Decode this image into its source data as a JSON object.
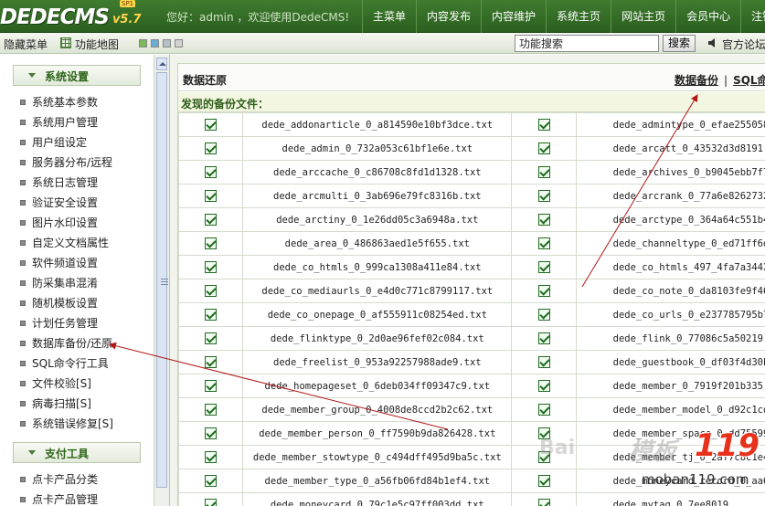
{
  "header": {
    "logo_text": "DEDECMS",
    "logo_version": "v5.7",
    "logo_badge": "SP1",
    "welcome": "您好：admin ，欢迎使用DedeCMS!",
    "nav": [
      "主菜单",
      "内容发布",
      "内容维护",
      "系统主页",
      "网站主页",
      "会员中心",
      "注销"
    ]
  },
  "toolbar": {
    "hide_menu": "隐藏菜单",
    "sitemap": "功能地图",
    "search_value": "功能搜索",
    "search_button": "搜索",
    "forum": "官方论坛",
    "swatch_colors": [
      "#7cb95a",
      "#6aaed8",
      "#b9bfc6",
      "#d2d2d2"
    ]
  },
  "sidebar": {
    "section1": "系统设置",
    "items1": [
      "系统基本参数",
      "系统用户管理",
      "用户组设定",
      "服务器分布/远程",
      "系统日志管理",
      "验证安全设置",
      "图片水印设置",
      "自定义文档属性",
      "软件频道设置",
      "防采集串混淆",
      "随机模板设置",
      "计划任务管理",
      "数据库备份/还原",
      "SQL命令行工具",
      "文件校验[S]",
      "病毒扫描[S]",
      "系统错误修复[S]"
    ],
    "section2": "支付工具",
    "items2": [
      "点卡产品分类",
      "点卡产品管理"
    ]
  },
  "main": {
    "title": "数据还原",
    "link_backup": "数据备份",
    "link_sql": "SQL命",
    "subtitle": "发现的备份文件：",
    "files_left": [
      "dede_addonarticle_0_a814590e10bf3dce.txt",
      "dede_admin_0_732a053c61bf1e6e.txt",
      "dede_arccache_0_c86708c8fd1d1328.txt",
      "dede_arcmulti_0_3ab696e79fc8316b.txt",
      "dede_arctiny_0_1e26dd05c3a6948a.txt",
      "dede_area_0_486863aed1e5f655.txt",
      "dede_co_htmls_0_999ca1308a411e84.txt",
      "dede_co_mediaurls_0_e4d0c771c8799117.txt",
      "dede_co_onepage_0_af555911c08254ed.txt",
      "dede_flinktype_0_2d0ae96fef02c084.txt",
      "dede_freelist_0_953a92257988ade9.txt",
      "dede_homepageset_0_6deb034ff09347c9.txt",
      "dede_member_group_0_4008de8ccd2b2c62.txt",
      "dede_member_person_0_ff7590b9da826428.txt",
      "dede_member_stowtype_0_c494dff495d9ba5c.txt",
      "dede_member_type_0_a56fb06fd84b1ef4.txt",
      "dede_moneycard_0_79c1e5c97ff003dd.txt"
    ],
    "files_right": [
      "dede_admintype_0_efae255058e",
      "dede_arcatt_0_43532d3d8191",
      "dede_archives_0_b9045ebb7f7",
      "dede_arcrank_0_77a6e8262732",
      "dede_arctype_0_364a64c551b4",
      "dede_channeltype_0_ed71ff6d4e",
      "dede_co_htmls_497_4fa7a3442e",
      "dede_co_note_0_da8103fe9f46",
      "dede_co_urls_0_e237785795b7",
      "dede_flink_0_77086c5a50219",
      "dede_guestbook_0_df03f4d30b4",
      "dede_member_0_7919f201b335",
      "dede_member_model_0_d92c1cd6b",
      "dede_member_space_0_dd755994",
      "dede_member_tj_0_2af7c8c1e4",
      "dede_moneycard_record_0_aa64",
      "dede_mytag_0_7ee8019"
    ]
  },
  "watermark": {
    "brand": "模板",
    "number": "119",
    "url": "moban119.com",
    "baidu": "Bai"
  }
}
